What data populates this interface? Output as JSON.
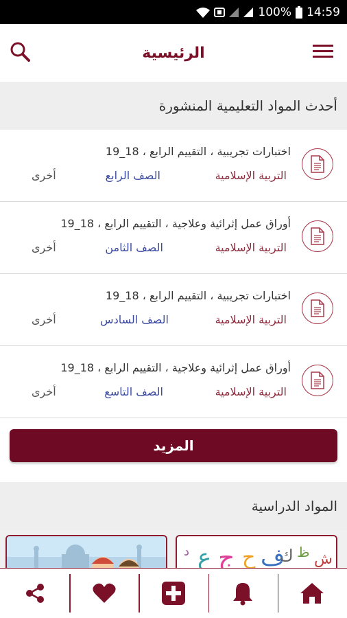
{
  "status_bar": {
    "battery": "100%",
    "time": "14:59"
  },
  "app_bar": {
    "title": "الرئيسية"
  },
  "latest": {
    "header": "أحدث المواد التعليمية المنشورة",
    "items": [
      {
        "title": "اختبارات تجريبية ، التقييم الرابع ، 18_19",
        "subject": "التربية الإسلامية",
        "grade": "الصف الرابع",
        "other": "أخرى"
      },
      {
        "title": "أوراق عمل إثرائية وعلاجية ، التقييم الرابع ، 18_19",
        "subject": "التربية الإسلامية",
        "grade": "الصف الثامن",
        "other": "أخرى"
      },
      {
        "title": "اختبارات تجريبية ، التقييم الرابع ، 18_19",
        "subject": "التربية الإسلامية",
        "grade": "الصف السادس",
        "other": "أخرى"
      },
      {
        "title": "أوراق عمل إثرائية وعلاجية ، التقييم الرابع ، 18_19",
        "subject": "التربية الإسلامية",
        "grade": "الصف التاسع",
        "other": "أخرى"
      }
    ],
    "more_label": "المزيد"
  },
  "subjects": {
    "header": "المواد الدراسية"
  },
  "icons": {
    "menu": "hamburger-menu-icon",
    "search": "search-icon",
    "document": "document-icon",
    "nav": [
      "home-icon",
      "bell-icon",
      "add-icon",
      "heart-icon",
      "share-icon"
    ]
  },
  "colors": {
    "brand": "#6e0a24",
    "accent": "#8e1b30",
    "grade": "#3b4aa0"
  }
}
